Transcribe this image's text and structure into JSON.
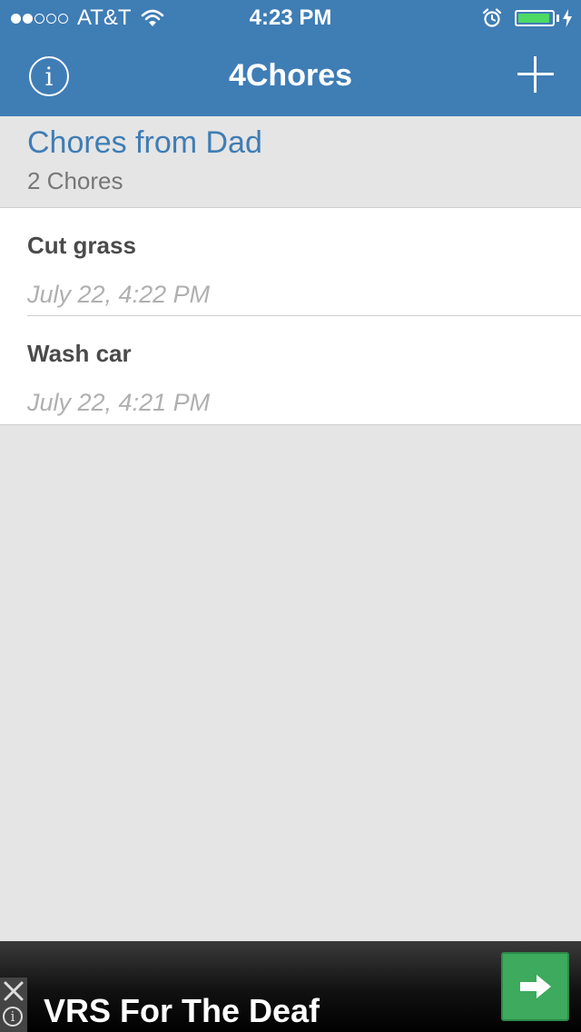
{
  "status_bar": {
    "carrier": "AT&T",
    "time": "4:23 PM",
    "signal_bars_filled": 2,
    "signal_bars_total": 5,
    "battery_level": 0.95,
    "battery_color": "#4cd964",
    "icons": [
      "wifi-icon",
      "alarm-icon",
      "charging-bolt-icon"
    ]
  },
  "nav": {
    "title": "4Chores",
    "left_icon": "info-icon",
    "right_icon": "plus-icon",
    "bar_color": "#3f7db5"
  },
  "list": {
    "title": "Chores from Dad",
    "count_label": "2 Chores"
  },
  "chores": [
    {
      "name": "Cut grass",
      "date": "July 22, 4:22 PM"
    },
    {
      "name": "Wash car",
      "date": "July 22, 4:21 PM"
    }
  ],
  "ad": {
    "text": "VRS For The Deaf",
    "button_icon": "arrow-right-icon",
    "button_color": "#3daa5e",
    "close_icon": "close-icon",
    "info_icon": "info-icon"
  }
}
